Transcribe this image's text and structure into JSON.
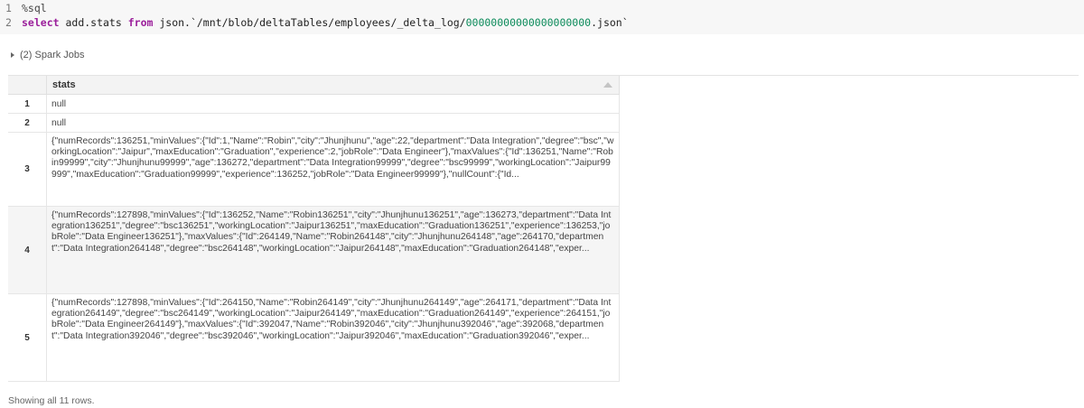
{
  "code": {
    "line_numbers": [
      "1",
      "2"
    ],
    "magic": "%sql",
    "kw_select": "select",
    "column_ref": " add.stats ",
    "kw_from": "from",
    "source_prefix": " json.`/mnt/blob/deltaTables/employees/_delta_log/",
    "file_number": "00000000000000000000",
    "source_suffix": ".json`"
  },
  "spark_jobs": {
    "label": "(2) Spark Jobs"
  },
  "table": {
    "columns": [
      "stats"
    ],
    "rows": [
      {
        "index": "1",
        "stats": "null"
      },
      {
        "index": "2",
        "stats": "null"
      },
      {
        "index": "3",
        "stats": "{\"numRecords\":136251,\"minValues\":{\"Id\":1,\"Name\":\"Robin\",\"city\":\"Jhunjhunu\",\"age\":22,\"department\":\"Data Integration\",\"degree\":\"bsc\",\"workingLocation\":\"Jaipur\",\"maxEducation\":\"Graduation\",\"experience\":2,\"jobRole\":\"Data Engineer\"},\"maxValues\":{\"Id\":136251,\"Name\":\"Robin99999\",\"city\":\"Jhunjhunu99999\",\"age\":136272,\"department\":\"Data Integration99999\",\"degree\":\"bsc99999\",\"workingLocation\":\"Jaipur99999\",\"maxEducation\":\"Graduation99999\",\"experience\":136252,\"jobRole\":\"Data Engineer99999\"},\"nullCount\":{\"Id..."
      },
      {
        "index": "4",
        "stats": "{\"numRecords\":127898,\"minValues\":{\"Id\":136252,\"Name\":\"Robin136251\",\"city\":\"Jhunjhunu136251\",\"age\":136273,\"department\":\"Data Integration136251\",\"degree\":\"bsc136251\",\"workingLocation\":\"Jaipur136251\",\"maxEducation\":\"Graduation136251\",\"experience\":136253,\"jobRole\":\"Data Engineer136251\"},\"maxValues\":{\"Id\":264149,\"Name\":\"Robin264148\",\"city\":\"Jhunjhunu264148\",\"age\":264170,\"department\":\"Data Integration264148\",\"degree\":\"bsc264148\",\"workingLocation\":\"Jaipur264148\",\"maxEducation\":\"Graduation264148\",\"exper..."
      },
      {
        "index": "5",
        "stats": "{\"numRecords\":127898,\"minValues\":{\"Id\":264150,\"Name\":\"Robin264149\",\"city\":\"Jhunjhunu264149\",\"age\":264171,\"department\":\"Data Integration264149\",\"degree\":\"bsc264149\",\"workingLocation\":\"Jaipur264149\",\"maxEducation\":\"Graduation264149\",\"experience\":264151,\"jobRole\":\"Data Engineer264149\"},\"maxValues\":{\"Id\":392047,\"Name\":\"Robin392046\",\"city\":\"Jhunjhunu392046\",\"age\":392068,\"department\":\"Data Integration392046\",\"degree\":\"bsc392046\",\"workingLocation\":\"Jaipur392046\",\"maxEducation\":\"Graduation392046\",\"exper..."
      }
    ]
  },
  "footer": {
    "text": "Showing all 11 rows."
  }
}
